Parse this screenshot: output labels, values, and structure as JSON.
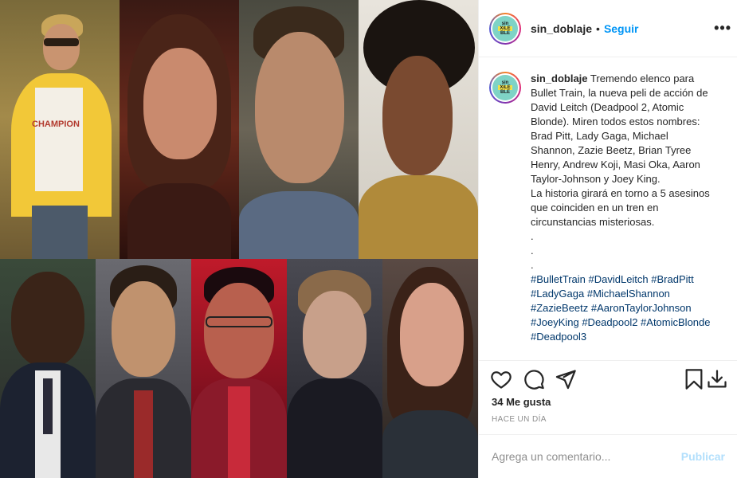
{
  "post": {
    "username": "sin_doblaje",
    "follow_label": "Seguir",
    "dot": "•",
    "more_label": "•••",
    "avatar_text_top": "sin",
    "avatar_text_mid": "XiLE",
    "avatar_text_bot": "BLE"
  },
  "caption": {
    "username": "sin_doblaje",
    "lines": [
      "Tremendo elenco para",
      "Bullet Train, la nueva peli de acción de",
      "David Leitch (Deadpool 2, Atomic",
      "Blonde). Miren todos estos nombres:",
      "Brad Pitt, Lady Gaga, Michael",
      "Shannon, Zazie Beetz, Brian Tyree",
      "Henry, Andrew Koji, Masi Oka, Aaron",
      "Taylor-Johnson y Joey King.",
      "La historia girará en torno a 5 asesinos",
      "que coinciden en un tren en",
      "circunstancias misteriosas.",
      ".",
      ".",
      "."
    ],
    "hashtag_lines": [
      "#BulletTrain #DavidLeitch #BradPitt",
      "#LadyGaga #MichaelShannon",
      "#ZazieBeetz #AaronTaylorJohnson",
      "#JoeyKing #Deadpool2 #AtomicBlonde",
      "#Deadpool3"
    ]
  },
  "actions": {
    "like_icon": "heart-icon",
    "comment_icon": "comment-icon",
    "share_icon": "share-icon",
    "save_icon": "bookmark-icon",
    "download_icon": "download-icon"
  },
  "likes_text": "34 Me gusta",
  "time_text": "HACE UN DÍA",
  "comment": {
    "placeholder": "Agrega un comentario...",
    "publish_label": "Publicar"
  },
  "photo": {
    "shirt_text": "CHAMPION"
  }
}
